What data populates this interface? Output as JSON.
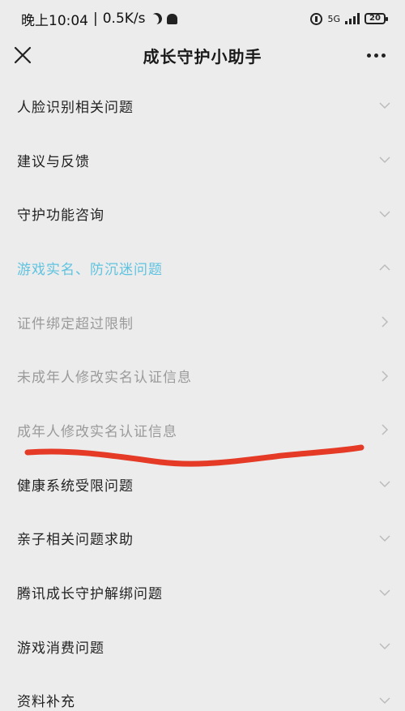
{
  "status_bar": {
    "time": "晚上10:04",
    "separator": "|",
    "net_speed": "0.5K/s",
    "network": "5G",
    "battery": "20"
  },
  "nav": {
    "title": "成长守护小助手"
  },
  "menu": [
    {
      "label": "人脸识别相关问题",
      "state": "collapsed"
    },
    {
      "label": "建议与反馈",
      "state": "collapsed"
    },
    {
      "label": "守护功能咨询",
      "state": "collapsed"
    },
    {
      "label": "游戏实名、防沉迷问题",
      "state": "expanded"
    },
    {
      "label": "证件绑定超过限制",
      "state": "sub"
    },
    {
      "label": "未成年人修改实名认证信息",
      "state": "sub"
    },
    {
      "label": "成年人修改实名认证信息",
      "state": "sub"
    },
    {
      "label": "健康系统受限问题",
      "state": "collapsed"
    },
    {
      "label": "亲子相关问题求助",
      "state": "collapsed"
    },
    {
      "label": "腾讯成长守护解绑问题",
      "state": "collapsed"
    },
    {
      "label": "游戏消费问题",
      "state": "collapsed"
    },
    {
      "label": "资料补充",
      "state": "collapsed"
    }
  ],
  "colors": {
    "background": "#ececec",
    "active": "#5fc3e0",
    "sub_text": "#9a9a9a",
    "annotation": "#e43a26"
  },
  "icons": {
    "close": "close-icon",
    "more": "more-dots-icon",
    "collapsed": "chevron-down-icon",
    "expanded": "chevron-up-icon",
    "sub": "chevron-right-icon"
  }
}
